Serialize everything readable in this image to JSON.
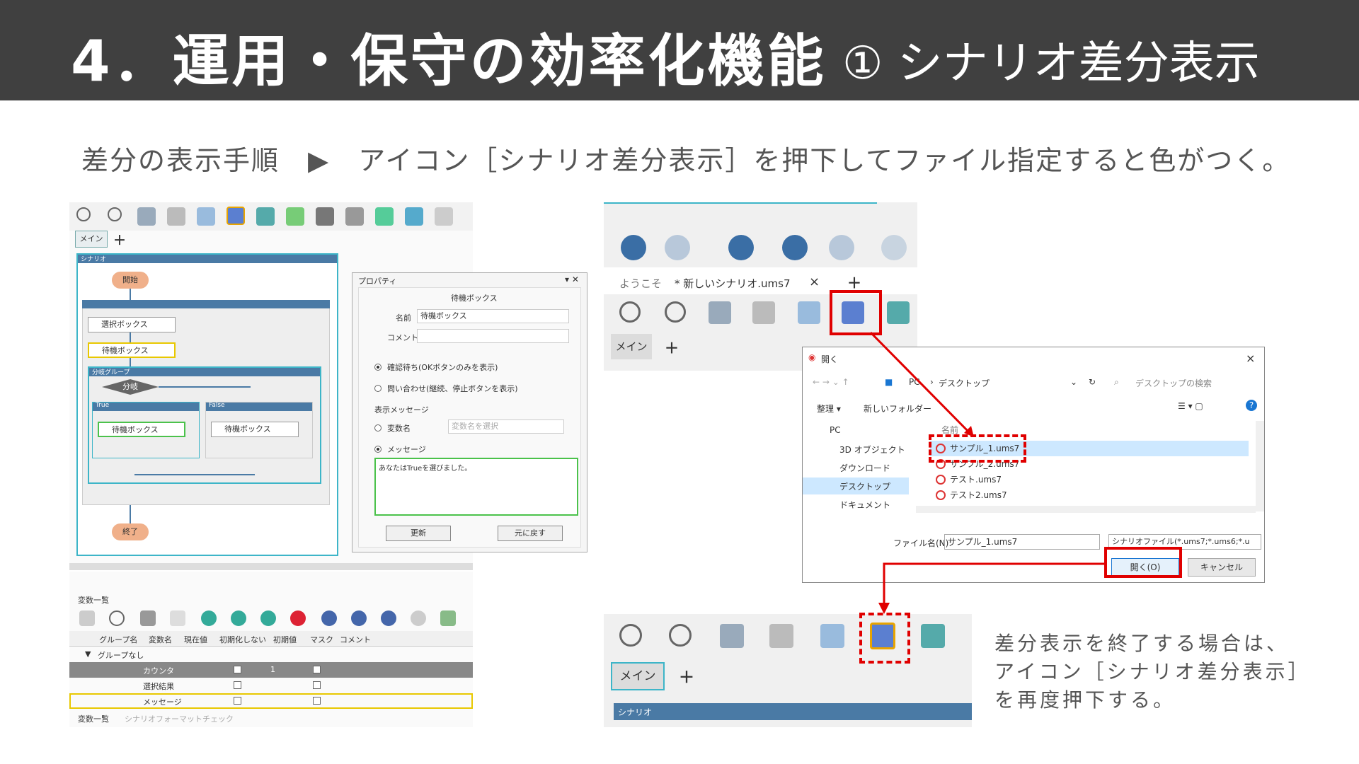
{
  "header": {
    "title": "4．運用・保守の効率化機能",
    "subtitle": "① シナリオ差分表示"
  },
  "description": "差分の表示手順　▶　アイコン［シナリオ差分表示］を押下してファイル指定すると色がつく。",
  "left_editor": {
    "tab_main": "メイン",
    "tab_add": "＋",
    "scenario_label": "シナリオ",
    "start_node": "開始",
    "select_box": "選択ボックス",
    "wait_box": "待機ボックス",
    "branch_group": "分岐グループ",
    "branch": "分岐",
    "true_label": "True",
    "false_label": "False",
    "wait_box_true": "待機ボックス",
    "wait_box_false": "待機ボックス",
    "end_node": "終了"
  },
  "properties": {
    "panel_title": "プロパティ",
    "heading": "待機ボックス",
    "name_label": "名前",
    "name_value": "待機ボックス",
    "comment_label": "コメント",
    "radio1": "確認待ち(OKボタンのみを表示)",
    "radio2": "問い合わせ(継続、停止ボタンを表示)",
    "message_section": "表示メッセージ",
    "var_name_label": "変数名",
    "var_placeholder": "変数名を選択",
    "message_label": "メッセージ",
    "message_text": "あなたはTrueを選びました。",
    "update_button": "更新",
    "revert_button": "元に戻す"
  },
  "variables": {
    "panel_title": "変数一覧",
    "columns": [
      "グループ名",
      "変数名",
      "現在値",
      "初期化しない",
      "初期値",
      "マスク",
      "コメント"
    ],
    "group_row": "グループなし",
    "rows": [
      {
        "name": "カウンタ",
        "initial": "1"
      },
      {
        "name": "選択結果",
        "initial": ""
      },
      {
        "name": "メッセージ",
        "initial": ""
      }
    ],
    "bottom_tab1": "変数一覧",
    "bottom_tab2": "シナリオフォーマットチェック"
  },
  "app_panel": {
    "tab_welcome": "ようこそ",
    "tab_file": "* 新しいシナリオ.ums7",
    "tab_close": "×",
    "tab_add": "＋",
    "tab_main": "メイン",
    "tab_main_add": "＋"
  },
  "open_dialog": {
    "title": "開く",
    "close": "×",
    "path_pc": "PC",
    "path_desktop": "デスクトップ",
    "search_placeholder": "デスクトップの検索",
    "organize": "整理 ▾",
    "new_folder": "新しいフォルダー",
    "nav_items": [
      "PC",
      "3D オブジェクト",
      "ダウンロード",
      "デスクトップ",
      "ドキュメント"
    ],
    "column_name": "名前",
    "files": [
      "サンプル_1.ums7",
      "サンプル_2.ums7",
      "テスト.ums7",
      "テスト2.ums7"
    ],
    "filename_label": "ファイル名(N):",
    "filename_value": "サンプル_1.ums7",
    "filetype_value": "シナリオファイル(*.ums7;*.ums6;*.u",
    "open_button": "開く(O)",
    "cancel_button": "キャンセル"
  },
  "bottom_panel": {
    "tab_main": "メイン",
    "tab_add": "＋",
    "scenario_label": "シナリオ"
  },
  "note": {
    "line1": "差分表示を終了する場合は、",
    "line2": "アイコン［シナリオ差分表示］",
    "line3": "を再度押下する。"
  },
  "colors": {
    "title_bg": "#404040",
    "highlight_red": "#e00000",
    "scenario_blue": "#4a7aa5",
    "accent_teal": "#3db5c8"
  }
}
